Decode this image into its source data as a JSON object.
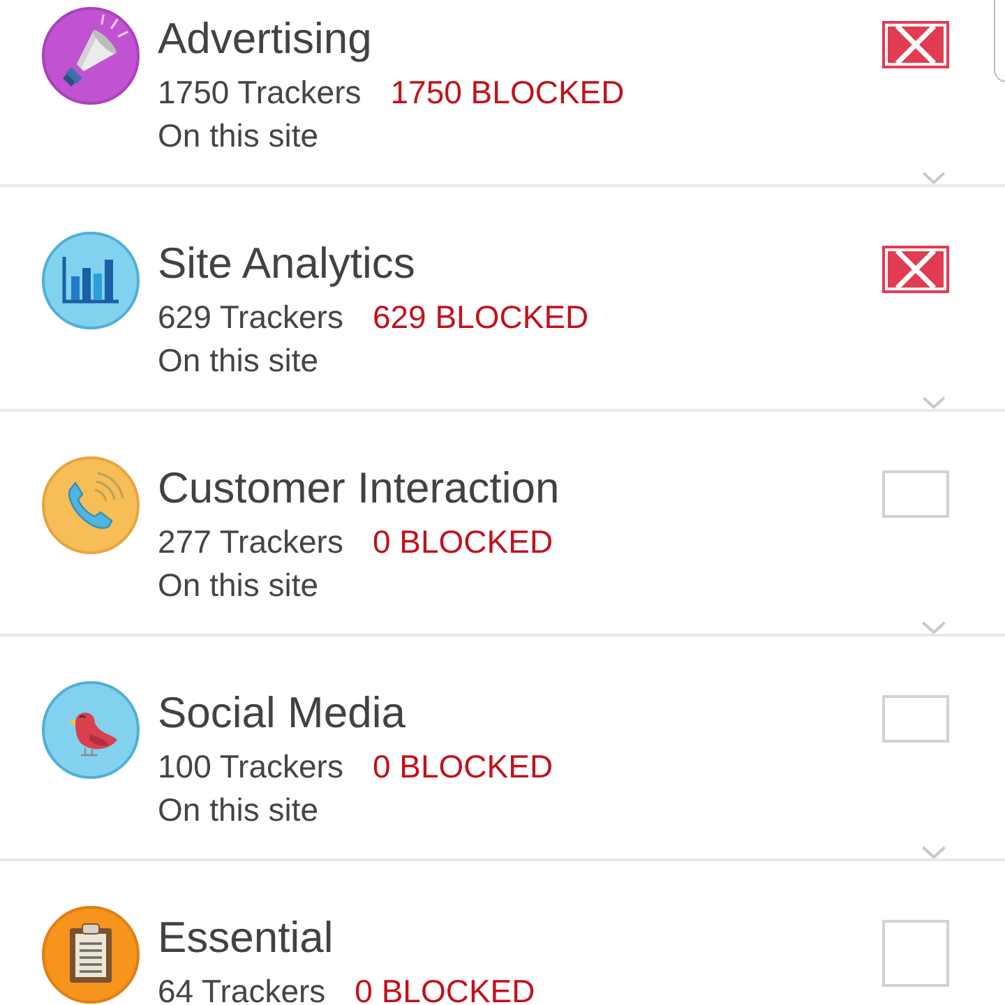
{
  "categories": [
    {
      "kind": "megaphone",
      "name": "Advertising",
      "trackers": "1750 Trackers",
      "blocked": "1750 BLOCKED",
      "scope": "On this site",
      "checked": true
    },
    {
      "kind": "chart",
      "name": "Site Analytics",
      "trackers": "629 Trackers",
      "blocked": "629 BLOCKED",
      "scope": "On this site",
      "checked": true
    },
    {
      "kind": "phone",
      "name": "Customer Interaction",
      "trackers": "277 Trackers",
      "blocked": "0 BLOCKED",
      "scope": "On this site",
      "checked": false
    },
    {
      "kind": "bird",
      "name": "Social Media",
      "trackers": "100 Trackers",
      "blocked": "0 BLOCKED",
      "scope": "On this site",
      "checked": false
    },
    {
      "kind": "clipboard",
      "name": "Essential",
      "trackers": "64 Trackers",
      "blocked": "0 BLOCKED",
      "checked": false
    }
  ]
}
